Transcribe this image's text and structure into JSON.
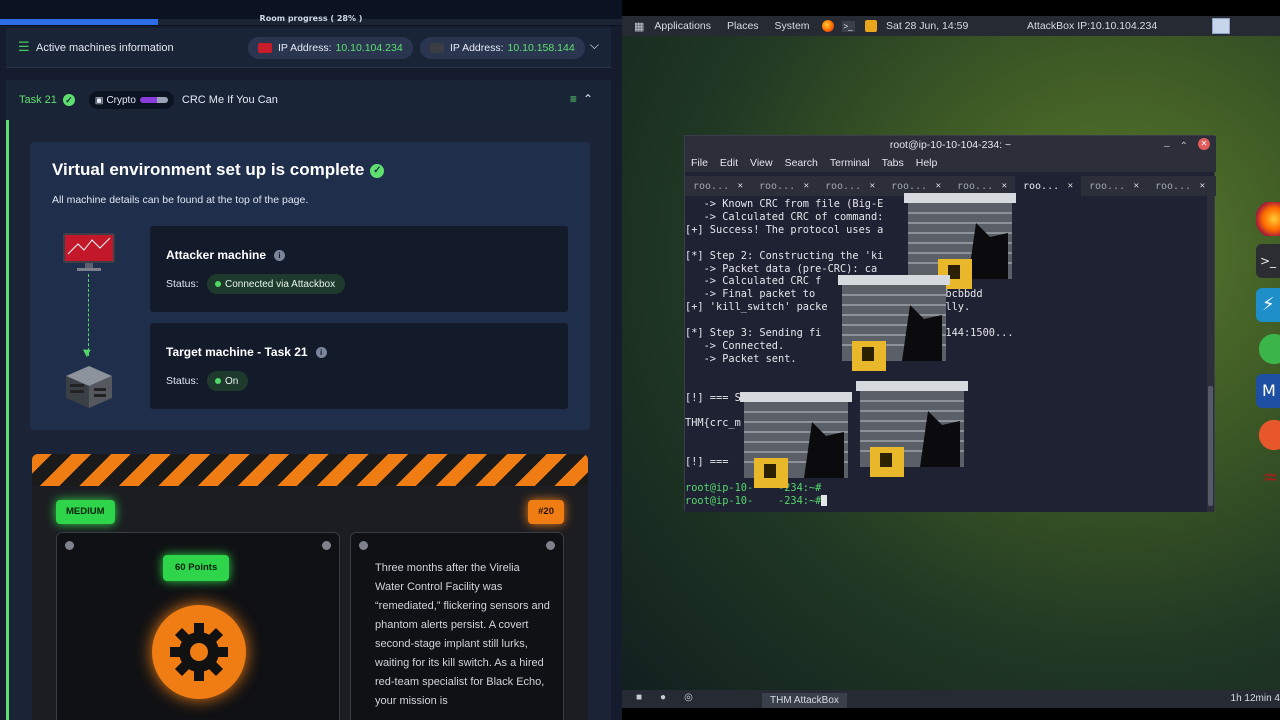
{
  "room": {
    "progress_label": "Room progress ( 28% )",
    "progress_fraction": 0.25
  },
  "machines_bar": {
    "title": "Active machines information",
    "ip1_label": "IP Address:",
    "ip1_value": "10.10.104.234",
    "ip2_label": "IP Address:",
    "ip2_value": "10.10.158.144"
  },
  "task": {
    "label": "Task 21",
    "tag": "Crypto",
    "title": "CRC Me If You Can"
  },
  "env": {
    "title": "Virtual environment set up is complete",
    "description": "All machine details can be found at the top of the page.",
    "attacker_name": "Attacker machine",
    "attacker_status_label": "Status:",
    "attacker_status": "Connected via Attackbox",
    "target_name": "Target machine - Task 21",
    "target_status_label": "Status:",
    "target_status": "On"
  },
  "challenge": {
    "difficulty": "MEDIUM",
    "number": "#20",
    "points": "60 Points",
    "story": "Three months after the Virelia Water Control Facility was “remediated,” flickering sensors and phantom alerts persist. A covert second-stage implant still lurks, waiting for its kill switch. As a hired red-team specialist for Black Echo, your mission is"
  },
  "desktop": {
    "menu": [
      "Applications",
      "Places",
      "System"
    ],
    "clock": "Sat 28 Jun, 14:59",
    "attackbox_ip": "AttackBox IP:10.10.104.234",
    "taskbar_item": "THM AttackBox",
    "bottom_right": "1h 12min 4"
  },
  "terminal": {
    "title": "root@ip-10-10-104-234: ~",
    "menu": [
      "File",
      "Edit",
      "View",
      "Search",
      "Terminal",
      "Tabs",
      "Help"
    ],
    "tabs": [
      "roo...",
      "roo...",
      "roo...",
      "roo...",
      "roo...",
      "roo...",
      "roo...",
      "roo..."
    ],
    "active_tab": 5,
    "lines": [
      "   -> Known CRC from file (Big-E",
      "   -> Calculated CRC of command:",
      "[+] Success! The protocol uses a",
      "",
      "[*] Step 2: Constructing the 'ki",
      "   -> Packet data (pre-CRC): ca",
      "   -> Calculated CRC f",
      "   -> Final packet to                 4c31bcbbdd",
      "[+] 'kill_switch' packe               esfully.",
      "",
      "[*] Step 3: Sending fi                158.144:1500...",
      "   -> Connected.",
      "   -> Packet sent.",
      "",
      "",
      "[!] === S",
      "",
      "THM{crc_m",
      "",
      "",
      "[!] ===",
      ""
    ],
    "prompt1": "root@ip-10-    -234:~#",
    "prompt2": "root@ip-10-    -234:~#"
  },
  "colors": {
    "accent_green": "#5de06e",
    "warning_orange": "#f07d13",
    "panel_blue": "#1f2e4a"
  }
}
